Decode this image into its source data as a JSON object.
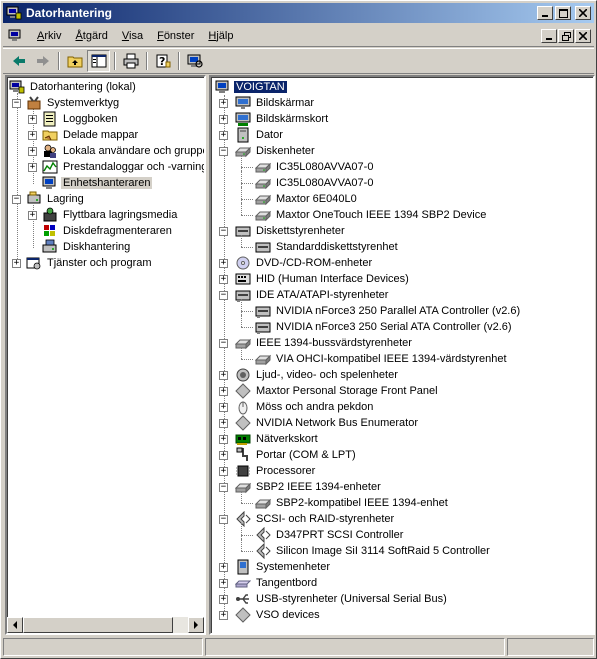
{
  "window": {
    "title": "Datorhantering"
  },
  "menu": [
    {
      "label": "Arkiv",
      "ul": "A",
      "rest": "rkiv"
    },
    {
      "label": "Åtgärd",
      "ul": "Å",
      "rest": "tgärd"
    },
    {
      "label": "Visa",
      "ul": "V",
      "rest": "isa"
    },
    {
      "label": "Fönster",
      "ul": "F",
      "rest": "önster"
    },
    {
      "label": "Hjälp",
      "ul": "H",
      "rest": "jälp"
    }
  ],
  "left_tree": {
    "root": "Datorhantering (lokal)",
    "systemverktyg": "Systemverktyg",
    "loggboken": "Loggboken",
    "delade_mappar": "Delade mappar",
    "lokala_anvandare": "Lokala användare och grupper",
    "prestandaloggar": "Prestandaloggar och -varningar",
    "enhetshanteraren": "Enhetshanteraren",
    "lagring": "Lagring",
    "flyttbara": "Flyttbara lagringsmedia",
    "diskdefrag": "Diskdefragmenteraren",
    "diskhantering": "Diskhantering",
    "tjanster": "Tjänster och program"
  },
  "device_tree": {
    "computer": "VOIGTAN",
    "nodes": [
      {
        "label": "Bildskärmar",
        "icon": "monitor-icon",
        "level": 1,
        "expander": "+"
      },
      {
        "label": "Bildskärmskort",
        "icon": "display-adapter-icon",
        "level": 1,
        "expander": "+"
      },
      {
        "label": "Dator",
        "icon": "computer-icon",
        "level": 1,
        "expander": "+"
      },
      {
        "label": "Diskenheter",
        "icon": "disk-drive-icon",
        "level": 1,
        "expander": "-"
      },
      {
        "label": "IC35L080AVVA07-0",
        "icon": "disk-drive-icon",
        "level": 2
      },
      {
        "label": "IC35L080AVVA07-0",
        "icon": "disk-drive-icon",
        "level": 2
      },
      {
        "label": "Maxtor 6E040L0",
        "icon": "disk-drive-icon",
        "level": 2
      },
      {
        "label": "Maxtor OneTouch IEEE 1394 SBP2 Device",
        "icon": "disk-drive-icon",
        "level": 2
      },
      {
        "label": "Diskettstyrenheter",
        "icon": "floppy-controller-icon",
        "level": 1,
        "expander": "-"
      },
      {
        "label": "Standarddiskettstyrenhet",
        "icon": "floppy-controller-icon",
        "level": 2
      },
      {
        "label": "DVD-/CD-ROM-enheter",
        "icon": "cdrom-icon",
        "level": 1,
        "expander": "+"
      },
      {
        "label": "HID (Human Interface Devices)",
        "icon": "hid-icon",
        "level": 1,
        "expander": "+"
      },
      {
        "label": "IDE ATA/ATAPI-styrenheter",
        "icon": "ide-controller-icon",
        "level": 1,
        "expander": "-"
      },
      {
        "label": "NVIDIA nForce3 250 Parallel ATA Controller (v2.6)",
        "icon": "ide-controller-icon",
        "level": 2
      },
      {
        "label": "NVIDIA nForce3 250 Serial ATA Controller (v2.6)",
        "icon": "ide-controller-icon",
        "level": 2
      },
      {
        "label": "IEEE 1394-bussvärdstyrenheter",
        "icon": "ieee1394-icon",
        "level": 1,
        "expander": "-"
      },
      {
        "label": "VIA OHCI-kompatibel IEEE 1394-värdstyrenhet",
        "icon": "ieee1394-icon",
        "level": 2
      },
      {
        "label": "Ljud-, video- och spelenheter",
        "icon": "sound-icon",
        "level": 1,
        "expander": "+"
      },
      {
        "label": "Maxtor Personal Storage Front Panel",
        "icon": "generic-device-icon",
        "level": 1,
        "expander": "+"
      },
      {
        "label": "Möss och andra pekdon",
        "icon": "mouse-icon",
        "level": 1,
        "expander": "+"
      },
      {
        "label": "NVIDIA Network Bus Enumerator",
        "icon": "generic-device-icon",
        "level": 1,
        "expander": "+"
      },
      {
        "label": "Nätverkskort",
        "icon": "network-card-icon",
        "level": 1,
        "expander": "+"
      },
      {
        "label": "Portar (COM & LPT)",
        "icon": "port-icon",
        "level": 1,
        "expander": "+"
      },
      {
        "label": "Processorer",
        "icon": "processor-icon",
        "level": 1,
        "expander": "+"
      },
      {
        "label": "SBP2 IEEE 1394-enheter",
        "icon": "ieee1394-icon",
        "level": 1,
        "expander": "-"
      },
      {
        "label": "SBP2-kompatibel IEEE 1394-enhet",
        "icon": "ieee1394-icon",
        "level": 2
      },
      {
        "label": "SCSI- och RAID-styrenheter",
        "icon": "scsi-icon",
        "level": 1,
        "expander": "-"
      },
      {
        "label": "D347PRT SCSI Controller",
        "icon": "scsi-icon",
        "level": 2
      },
      {
        "label": "Silicon Image SiI 3114 SoftRaid 5 Controller",
        "icon": "scsi-icon",
        "level": 2
      },
      {
        "label": "Systemenheter",
        "icon": "system-devices-icon",
        "level": 1,
        "expander": "+"
      },
      {
        "label": "Tangentbord",
        "icon": "keyboard-icon",
        "level": 1,
        "expander": "+"
      },
      {
        "label": "USB-styrenheter (Universal Serial Bus)",
        "icon": "usb-icon",
        "level": 1,
        "expander": "+"
      },
      {
        "label": "VSO devices",
        "icon": "generic-device-icon",
        "level": 1,
        "expander": "+"
      }
    ]
  },
  "colors": {
    "titlebar_start": "#0a246a",
    "titlebar_end": "#a6caf0",
    "face": "#d4d0c8",
    "selection": "#0a246a"
  }
}
